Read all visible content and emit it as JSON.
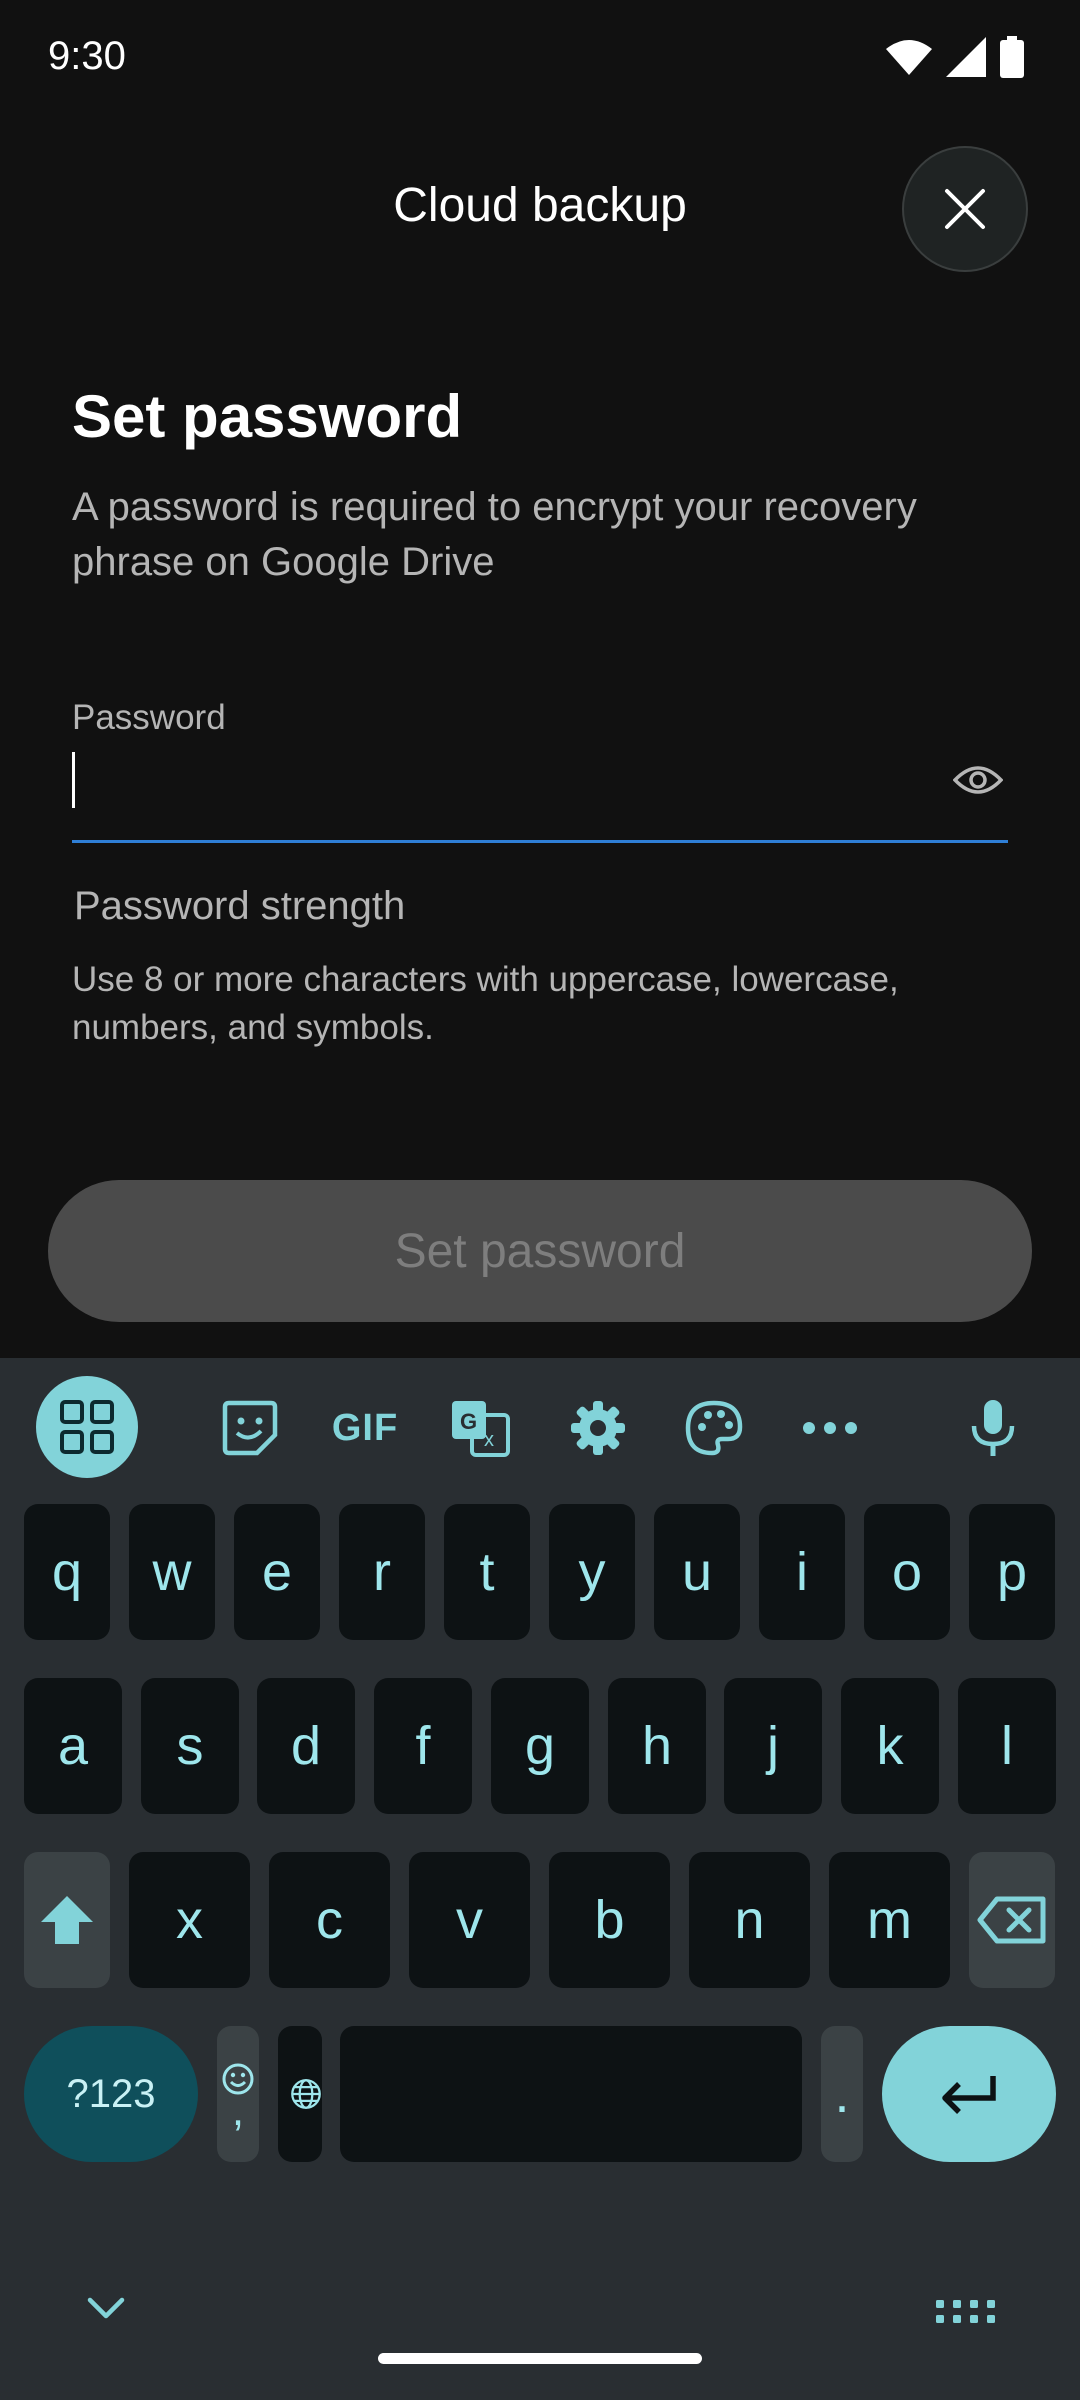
{
  "status_bar": {
    "time": "9:30"
  },
  "header": {
    "title": "Cloud backup",
    "close_icon": "close-icon"
  },
  "content": {
    "heading": "Set password",
    "subtitle": "A password is required to encrypt your recovery phrase on Google Drive",
    "password_field": {
      "label": "Password",
      "value": "",
      "toggle_icon": "eye-icon"
    },
    "strength_label": "Password strength",
    "hint": "Use 8 or more characters with uppercase, lowercase, numbers, and symbols.",
    "submit_label": "Set password"
  },
  "keyboard": {
    "toolbar": [
      "apps-grid-icon",
      "sticker-icon",
      "GIF",
      "translate-icon",
      "gear-icon",
      "palette-icon",
      "more-icon",
      "mic-icon"
    ],
    "row1": [
      "q",
      "w",
      "e",
      "r",
      "t",
      "y",
      "u",
      "i",
      "o",
      "p"
    ],
    "row2": [
      "a",
      "s",
      "d",
      "f",
      "g",
      "h",
      "j",
      "k",
      "l"
    ],
    "row3": [
      "x",
      "c",
      "v",
      "b",
      "n",
      "m"
    ],
    "symbols_label": "?123",
    "comma": ",",
    "period": ".",
    "colors": {
      "accent": "#82d3d9",
      "key_text": "#9ee6ec",
      "key_bg": "#0d1214",
      "keyboard_bg": "#292e32"
    }
  }
}
